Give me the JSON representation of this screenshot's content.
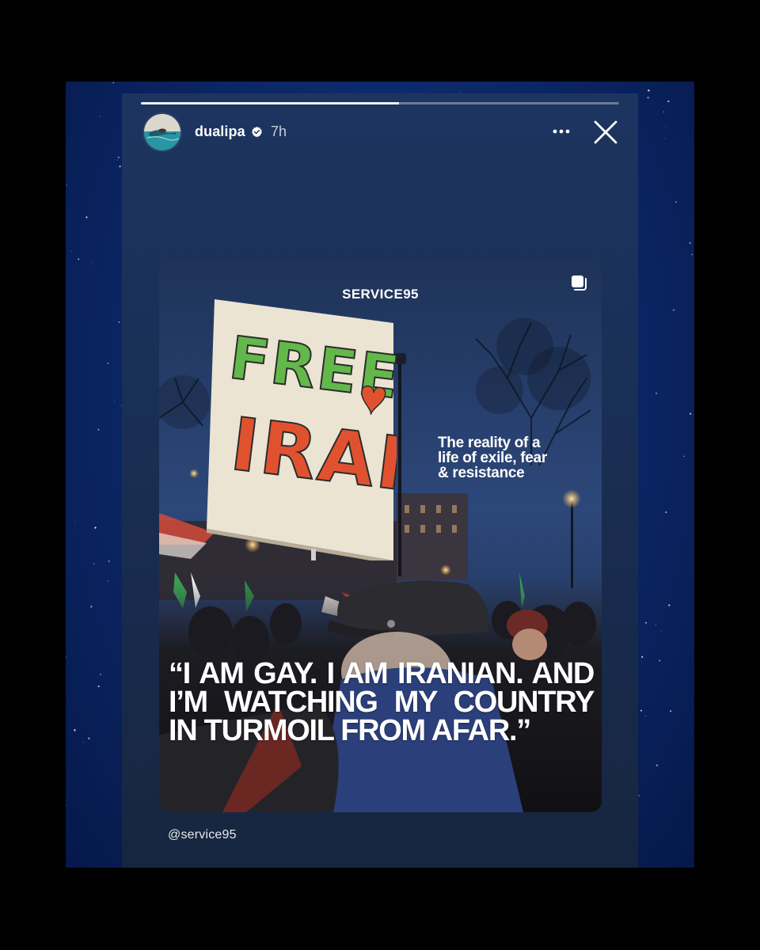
{
  "story": {
    "progress": 0.54,
    "user": {
      "username": "dualipa",
      "verified": true,
      "time_ago": "7h"
    },
    "icons": {
      "more": "more-horizontal-icon",
      "close": "close-icon",
      "verified": "verified-badge-icon",
      "multi_post": "multiple-posts-icon"
    }
  },
  "post": {
    "brand": "SERVICE95",
    "sign_text": [
      "FREE",
      "IRAN"
    ],
    "subtitle_lines": [
      "The reality of a",
      "life of exile, fear",
      "& resistance"
    ],
    "quote": "“I AM GAY. I AM IRANIAN. AND I’M WATCHING MY COUNTRY IN TURMOIL FROM AFAR.”",
    "mention": "@service95"
  },
  "colors": {
    "page_background": "#000000",
    "outer_frame": "#0c2a6c",
    "story_background": "#1a2f55",
    "sign_green": "#5fb548",
    "sign_red": "#e0522f"
  }
}
